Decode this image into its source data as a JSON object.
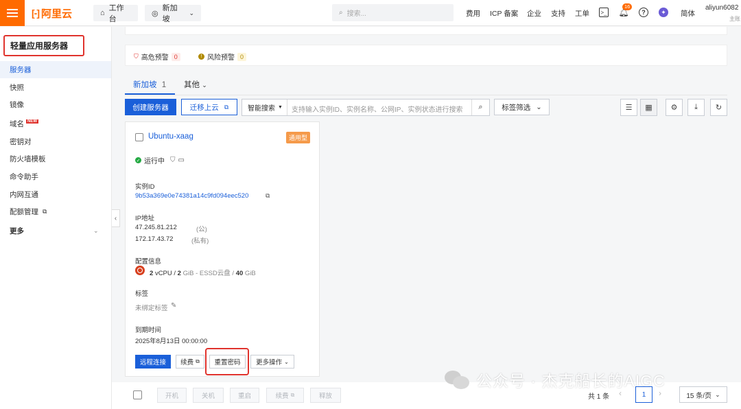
{
  "topbar": {
    "logo": "阿里云",
    "workbench": "工作台",
    "region": "新加坡",
    "search_placeholder": "搜索...",
    "links": [
      "费用",
      "ICP 备案",
      "企业",
      "支持",
      "工单"
    ],
    "notification_count": "16",
    "lang": "简体",
    "user": "aliyun6082",
    "user_sub": "主账"
  },
  "sidebar": {
    "title": "轻量应用服务器",
    "items": [
      {
        "label": "服务器"
      },
      {
        "label": "快照"
      },
      {
        "label": "镜像"
      },
      {
        "label": "域名",
        "badge": "NEW"
      },
      {
        "label": "密钥对"
      },
      {
        "label": "防火墙模板"
      },
      {
        "label": "命令助手"
      },
      {
        "label": "内网互通"
      },
      {
        "label": "配额管理"
      },
      {
        "label": "更多"
      }
    ]
  },
  "alerts": {
    "high_label": "高危预警",
    "high_count": "0",
    "risk_label": "风险预警",
    "risk_count": "0"
  },
  "tabs": {
    "region_tab": "新加坡",
    "region_count": "1",
    "other_tab": "其他"
  },
  "toolbar": {
    "create": "创建服务器",
    "migrate": "迁移上云",
    "search_type": "智能搜索",
    "search_placeholder": "支持输入实例ID、实例名称、公网IP、实例状态进行搜索",
    "tag_filter": "标签筛选"
  },
  "instance": {
    "name": "Ubuntu-xaag",
    "type": "通用型",
    "status": "运行中",
    "id_label": "实例ID",
    "id": "9b53a369e0e74381a14c9fd094eec520",
    "ip_label": "IP地址",
    "public_ip": "47.245.81.212",
    "public_tag": "(公)",
    "private_ip": "172.17.43.72",
    "private_tag": "(私有)",
    "config_label": "配置信息",
    "cpu_num": "2",
    "cpu_unit": "vCPU /",
    "mem_num": "2",
    "mem_unit": "GiB - ESSD云盘 /",
    "disk_num": "40",
    "disk_unit": "GiB",
    "tag_label": "标签",
    "tag_value": "未绑定标签",
    "expire_label": "到期时间",
    "expire": "2025年8月13日 00:00:00",
    "btn_remote": "远程连接",
    "btn_renew": "续费",
    "btn_reset": "重置密码",
    "btn_more": "更多操作"
  },
  "bottom": {
    "start": "开机",
    "stop": "关机",
    "restart": "重启",
    "renew": "续费",
    "release": "释放",
    "total": "共 1 条",
    "page": "1",
    "page_size": "15 条/页"
  },
  "watermark": "公众号 · 杰克船长的AIGC",
  "colors": {
    "accent": "#1a5fd9",
    "brand": "#ff6a00",
    "highlight": "#e0332d"
  }
}
